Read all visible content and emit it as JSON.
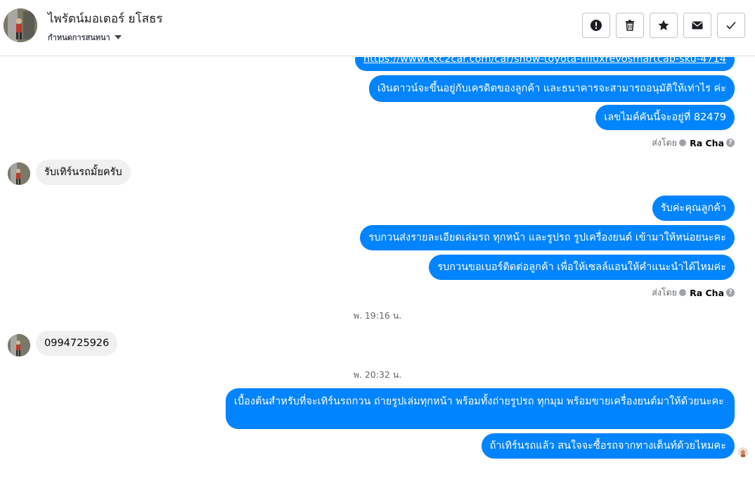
{
  "header": {
    "contact_name": "ไพรัตน์มอเตอร์ ยโสธร",
    "status_label": "กำหนดการสนทนา",
    "actions": [
      {
        "name": "report-button",
        "icon": "exclamation-icon"
      },
      {
        "name": "delete-button",
        "icon": "trash-icon"
      },
      {
        "name": "star-button",
        "icon": "star-icon"
      },
      {
        "name": "mark-unread-button",
        "icon": "envelope-icon"
      },
      {
        "name": "mark-done-button",
        "icon": "checkmark-icon"
      }
    ]
  },
  "messages": {
    "m1": "https://www.ckc2car.com/car/show-toyota-hiluxrevosmartcab-sku-4714",
    "m2": "เงินดาวน์จะขึ้นอยู่กับเครดิตของลูกค้า และธนาคารจะสามารถอนุมัติให้เท่าไร ค่ะ",
    "m3": "เลขไมค์คันนี้จะอยู่ที่ 82479",
    "sent_by_1_prefix": "ส่งโดย",
    "sent_by_1_agent": "Ra Cha",
    "m4": "รับเทิร์นรถมั้ยครับ",
    "m5": "รับค่ะคุณลูกค้า",
    "m6": "รบกวนส่งรายละเอียดเล่มรถ ทุกหน้า และรูปรถ รูปเครื่องยนต์ เข้ามาให้หน่อยนะคะ",
    "m7": "รบกวนขอเบอร์ติดต่อลูกค้า เพื่อให้เซลล์แอนให้คำแนะนำได้ไหมค่ะ",
    "sent_by_2_prefix": "ส่งโดย",
    "sent_by_2_agent": "Ra Cha",
    "ts1": "พ. 19:16 น.",
    "m8": "0994725926",
    "ts2": "พ. 20:32 น.",
    "m9": "เบื้องต้นสำหรับที่จะเทิร์นรถกวน ถ่ายรูปเล่มทุกหน้า พร้อมทั้งถ่ายรูปรถ ทุกมุม พร้อมขายเครื่องยนต์มาให้ด้วยนะคะ",
    "m10": "ถ้าเทิร์นรถแล้ว สนใจจะซื้อรถจากทางเต็นท์ด้วยไหมคะ"
  },
  "colors": {
    "outgoing_bubble": "#0084ff",
    "incoming_bubble": "#f0f0f0"
  }
}
